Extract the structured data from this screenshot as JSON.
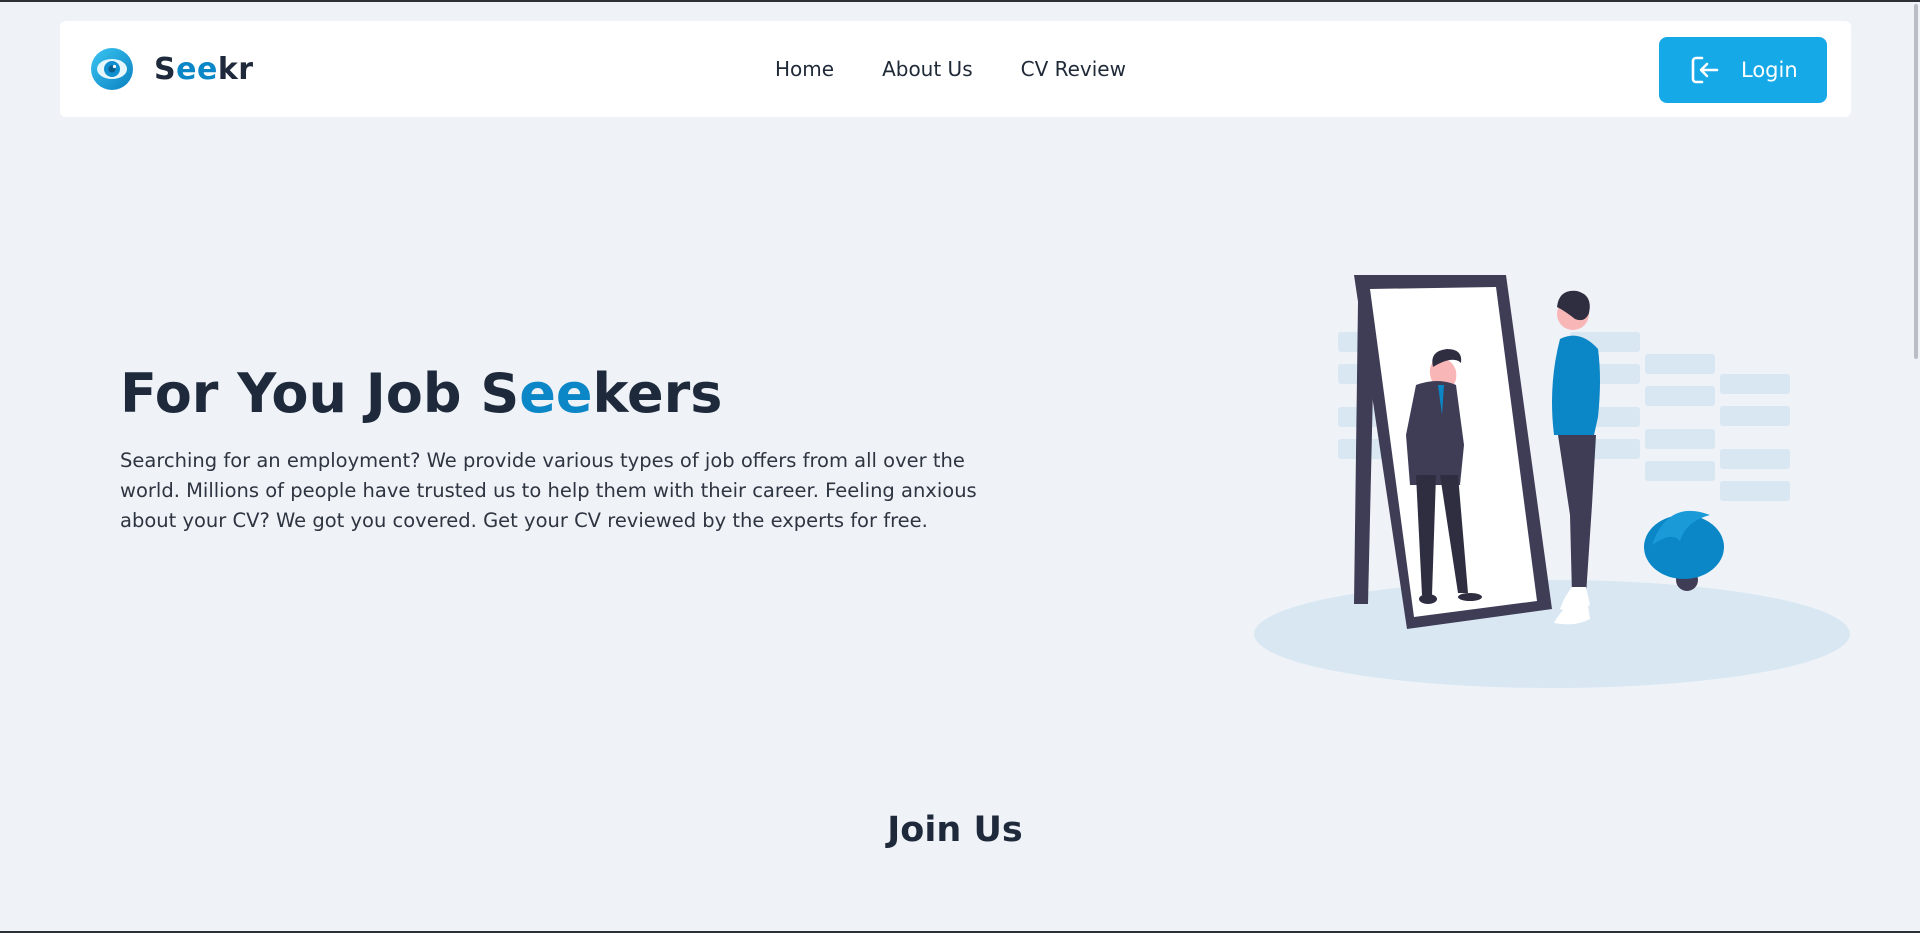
{
  "brand": {
    "name_prefix": "S",
    "name_accent": "ee",
    "name_suffix": "kr",
    "logo_icon": "eye-icon"
  },
  "nav": {
    "links": [
      {
        "label": "Home"
      },
      {
        "label": "About Us"
      },
      {
        "label": "CV Review"
      }
    ]
  },
  "login": {
    "label": "Login",
    "icon": "login-icon"
  },
  "hero": {
    "title_prefix": "For You Job S",
    "title_accent": "ee",
    "title_suffix": "kers",
    "description": "Searching for an employment? We provide various types of job offers from all over the world. Millions of people have trusted us to help them with their career. Feeling anxious about your CV? We got you covered. Get your CV reviewed by the experts for free."
  },
  "join": {
    "title": "Join Us"
  },
  "colors": {
    "accent": "#0b86c6",
    "button": "#15a9e8",
    "background": "#eff3f8",
    "text": "#1e2a3b"
  }
}
